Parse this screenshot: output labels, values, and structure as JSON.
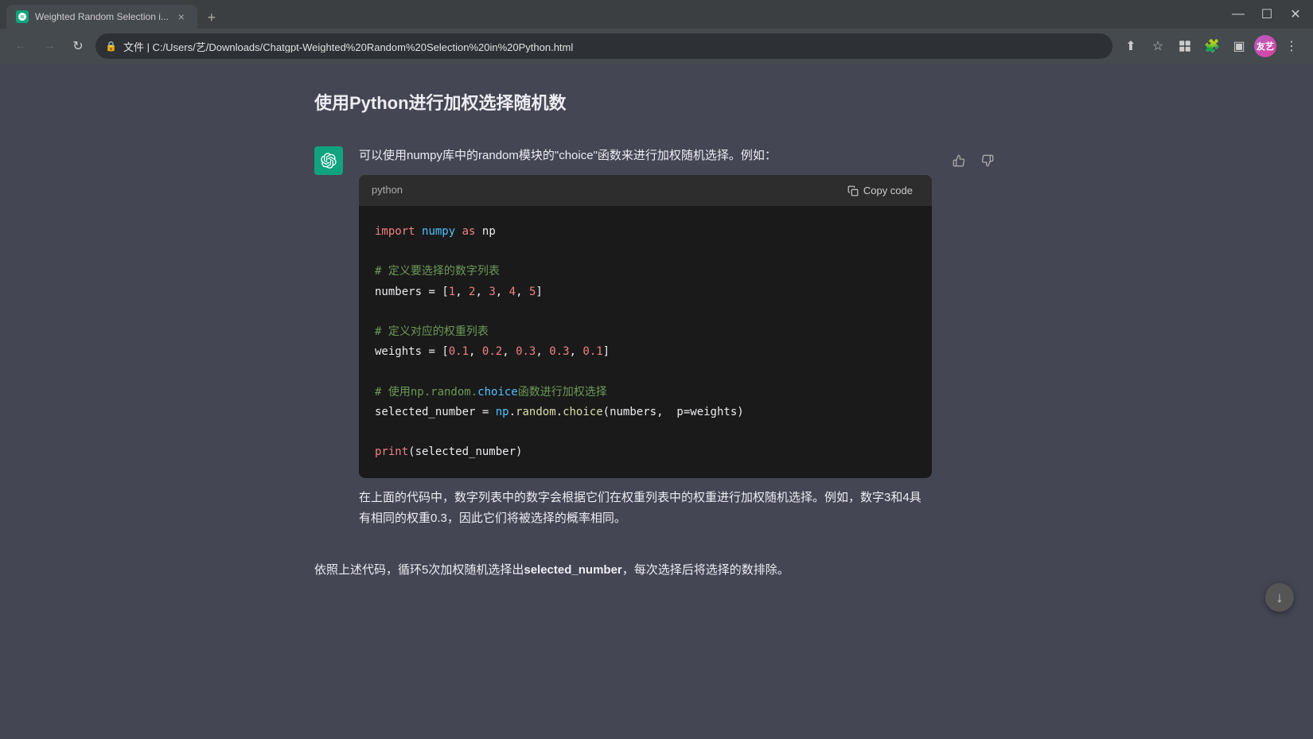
{
  "browser": {
    "tab": {
      "favicon_color": "#10a37f",
      "title": "Weighted Random Selection i...",
      "close_label": "×"
    },
    "new_tab_label": "+",
    "window_controls": {
      "minimize": "—",
      "maximize": "☐",
      "close": "✕"
    },
    "nav": {
      "back_disabled": true,
      "forward_disabled": true,
      "refresh_label": "↻",
      "lock_label": "🔒",
      "address": "文件 | C:/Users/艺/Downloads/Chatgpt-Weighted%20Random%20Selection%20in%20Python.html",
      "share_label": "⬆",
      "bookmark_label": "☆",
      "extensions_label": "⊞",
      "puzzle_label": "🧩",
      "sidebar_label": "▣",
      "avatar_label": "友艺",
      "menu_label": "⋮"
    }
  },
  "page": {
    "title": "使用Python进行加权选择随机数",
    "message": {
      "text_before": "可以使用numpy库中的random模块的\"choice\"函数来进行加权随机选择。例如：",
      "code_block": {
        "lang": "python",
        "copy_label": "Copy code",
        "lines": [
          {
            "type": "import",
            "content": "import numpy as np"
          },
          {
            "type": "blank"
          },
          {
            "type": "comment",
            "content": "# 定义要选择的数字列表"
          },
          {
            "type": "code",
            "content": "numbers = [1, 2, 3, 4, 5]"
          },
          {
            "type": "blank"
          },
          {
            "type": "comment",
            "content": "# 定义对应的权重列表"
          },
          {
            "type": "code",
            "content": "weights = [0.1, 0.2, 0.3, 0.3, 0.1]"
          },
          {
            "type": "blank"
          },
          {
            "type": "comment",
            "content": "# 使用np.random.choice函数进行加权选择"
          },
          {
            "type": "code",
            "content": "selected_number = np.random.choice(numbers,  p=weights)"
          },
          {
            "type": "blank"
          },
          {
            "type": "code2",
            "content": "print(selected_number)"
          }
        ]
      },
      "description": "在上面的代码中，数字列表中的数字会根据它们在权重列表中的权重进行加权随机选择。例如，数字3和4具有相同的权重0.3，因此它们将被选择的概率相同。"
    },
    "bottom_text": "依照上述代码，循环5次加权随机选择出selected_number，每次选择后将选择的数排除。"
  }
}
